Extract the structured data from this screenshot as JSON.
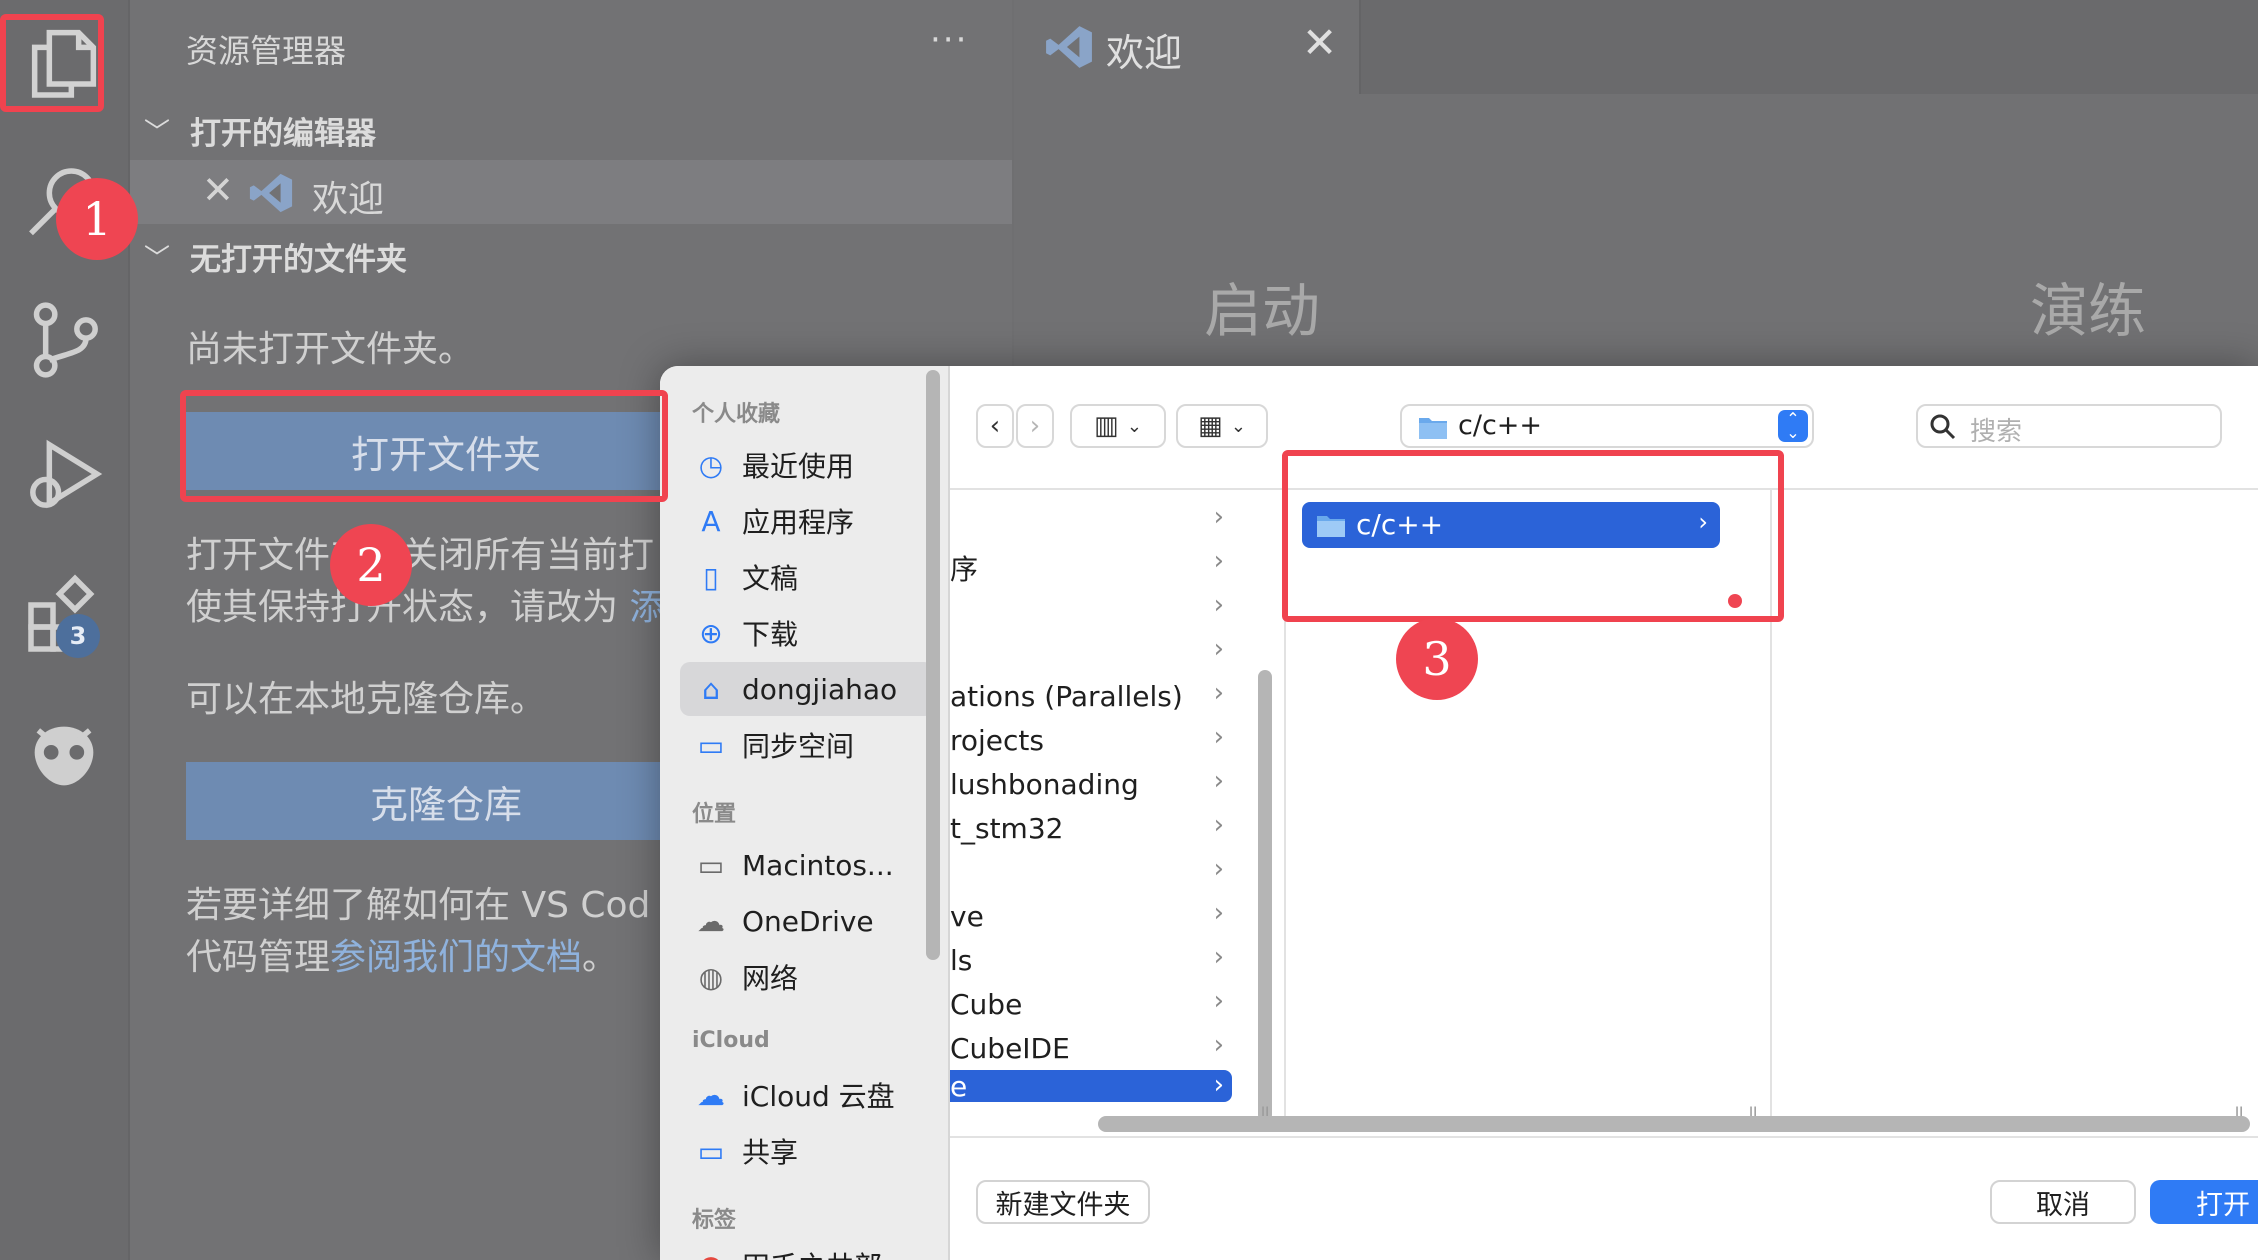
{
  "vscode": {
    "sidebar": {
      "title": "资源管理器",
      "more": "···",
      "open_editors_header": "打开的编辑器",
      "open_editor_item": "欢迎",
      "no_folder_header": "无打开的文件夹",
      "no_folder_text": "尚未打开文件夹。",
      "open_folder_button": "打开文件夹",
      "open_folder_note_line1": "打开文件夹将关闭所有当前打",
      "open_folder_note_line2": "使其保持打开状态，请改为",
      "open_folder_note_link": "添",
      "clone_text": "可以在本地克隆仓库。",
      "clone_button": "克隆仓库",
      "docs_line1": "若要详细了解如何在 VS Cod",
      "docs_line2_prefix": "代码管理",
      "docs_link": "参阅我们的文档",
      "docs_line2_suffix": "。"
    },
    "activity_bar": {
      "extensions_badge": "3"
    },
    "editor": {
      "tab_label": "欢迎",
      "heading_start": "启动",
      "heading_walkthrough": "演练"
    }
  },
  "dialog": {
    "sidebar": {
      "favorites_header": "个人收藏",
      "favorites": [
        {
          "label": "最近使用",
          "icon": "clock-icon"
        },
        {
          "label": "应用程序",
          "icon": "apps-icon"
        },
        {
          "label": "文稿",
          "icon": "document-icon"
        },
        {
          "label": "下载",
          "icon": "download-icon"
        },
        {
          "label": "dongjiahao",
          "icon": "home-icon",
          "selected": true
        },
        {
          "label": "同步空间",
          "icon": "folder-icon"
        }
      ],
      "locations_header": "位置",
      "locations": [
        {
          "label": "Macintos...",
          "icon": "disk-icon"
        },
        {
          "label": "OneDrive",
          "icon": "cloud-icon"
        },
        {
          "label": "网络",
          "icon": "globe-icon"
        }
      ],
      "icloud_header": "iCloud",
      "icloud": [
        {
          "label": "iCloud 云盘",
          "icon": "cloud-icon"
        },
        {
          "label": "共享",
          "icon": "shared-folder-icon"
        }
      ],
      "tags_header": "标签",
      "tags_partial": "田壬之共部"
    },
    "toolbar": {
      "path_label": "c/c++",
      "search_placeholder": "搜索"
    },
    "column1_rows": [
      {
        "label": ""
      },
      {
        "label": "序"
      },
      {
        "label": ""
      },
      {
        "label": ""
      },
      {
        "label": "ations (Parallels)"
      },
      {
        "label": "rojects"
      },
      {
        "label": "lushbonading"
      },
      {
        "label": "t_stm32"
      },
      {
        "label": ""
      },
      {
        "label": "ve"
      },
      {
        "label": "ls"
      },
      {
        "label": "Cube"
      },
      {
        "label": "CubeIDE"
      },
      {
        "label": "e",
        "selected": true
      }
    ],
    "column2_selected": "c/c++",
    "buttons": {
      "new_folder": "新建文件夹",
      "cancel": "取消",
      "open": "打开"
    }
  },
  "annotations": {
    "step1": "1",
    "step2": "2",
    "step3": "3",
    "color": "#f0434f"
  }
}
